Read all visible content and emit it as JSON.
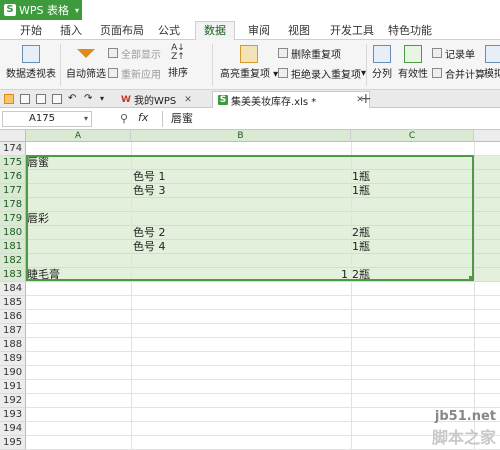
{
  "app": {
    "title": "WPS 表格"
  },
  "menu": {
    "tabs": [
      "开始",
      "插入",
      "页面布局",
      "公式",
      "数据",
      "审阅",
      "视图",
      "开发工具",
      "特色功能"
    ],
    "active": "数据"
  },
  "ribbon": {
    "pivot": "数据透视表",
    "autofilter": "自动筛选",
    "show_all": "全部显示",
    "reapply": "重新应用",
    "sort": "排序",
    "highlight_dup": "高亮重复项",
    "remove_dup": "删除重复项",
    "reject_dup": "拒绝录入重复项",
    "split": "分列",
    "validity": "有效性",
    "record": "记录单",
    "consolidate": "合并计算",
    "simulate": "模拟"
  },
  "doc_tabs": [
    {
      "label": "我的WPS",
      "icon": "W"
    },
    {
      "label": "集美美妆库存.xls *",
      "icon": "S"
    }
  ],
  "formula_bar": {
    "name_box": "A175",
    "fx": "fx",
    "content": "唇蜜"
  },
  "columns": [
    "A",
    "B",
    "C"
  ],
  "rows": [
    {
      "num": "174",
      "a": "",
      "b": "",
      "b_num": "",
      "c": ""
    },
    {
      "num": "175",
      "a": "唇蜜",
      "b": "",
      "b_num": "",
      "c": ""
    },
    {
      "num": "176",
      "a": "",
      "b": "色号  1",
      "b_num": "",
      "c": "1瓶"
    },
    {
      "num": "177",
      "a": "",
      "b": "色号  3",
      "b_num": "",
      "c": "1瓶"
    },
    {
      "num": "178",
      "a": "",
      "b": "",
      "b_num": "",
      "c": ""
    },
    {
      "num": "179",
      "a": "唇彩",
      "b": "",
      "b_num": "",
      "c": ""
    },
    {
      "num": "180",
      "a": "",
      "b": "色号  2",
      "b_num": "",
      "c": "2瓶"
    },
    {
      "num": "181",
      "a": "",
      "b": "色号  4",
      "b_num": "",
      "c": "1瓶"
    },
    {
      "num": "182",
      "a": "",
      "b": "",
      "b_num": "",
      "c": ""
    },
    {
      "num": "183",
      "a": "睫毛膏",
      "b": "",
      "b_num": "1",
      "c": "2瓶"
    },
    {
      "num": "184",
      "a": "",
      "b": "",
      "b_num": "",
      "c": ""
    },
    {
      "num": "185",
      "a": "",
      "b": "",
      "b_num": "",
      "c": ""
    },
    {
      "num": "186",
      "a": "",
      "b": "",
      "b_num": "",
      "c": ""
    },
    {
      "num": "187",
      "a": "",
      "b": "",
      "b_num": "",
      "c": ""
    },
    {
      "num": "188",
      "a": "",
      "b": "",
      "b_num": "",
      "c": ""
    },
    {
      "num": "189",
      "a": "",
      "b": "",
      "b_num": "",
      "c": ""
    },
    {
      "num": "190",
      "a": "",
      "b": "",
      "b_num": "",
      "c": ""
    },
    {
      "num": "191",
      "a": "",
      "b": "",
      "b_num": "",
      "c": ""
    },
    {
      "num": "192",
      "a": "",
      "b": "",
      "b_num": "",
      "c": ""
    },
    {
      "num": "193",
      "a": "",
      "b": "",
      "b_num": "",
      "c": ""
    },
    {
      "num": "194",
      "a": "",
      "b": "",
      "b_num": "",
      "c": ""
    },
    {
      "num": "195",
      "a": "",
      "b": "",
      "b_num": "",
      "c": ""
    }
  ],
  "watermark": {
    "site": "jb51.net",
    "text": "脚本之家"
  },
  "colors": {
    "accent": "#3d9a3d",
    "selection": "#4e9a44",
    "selection_fill": "#e3f1dc"
  }
}
